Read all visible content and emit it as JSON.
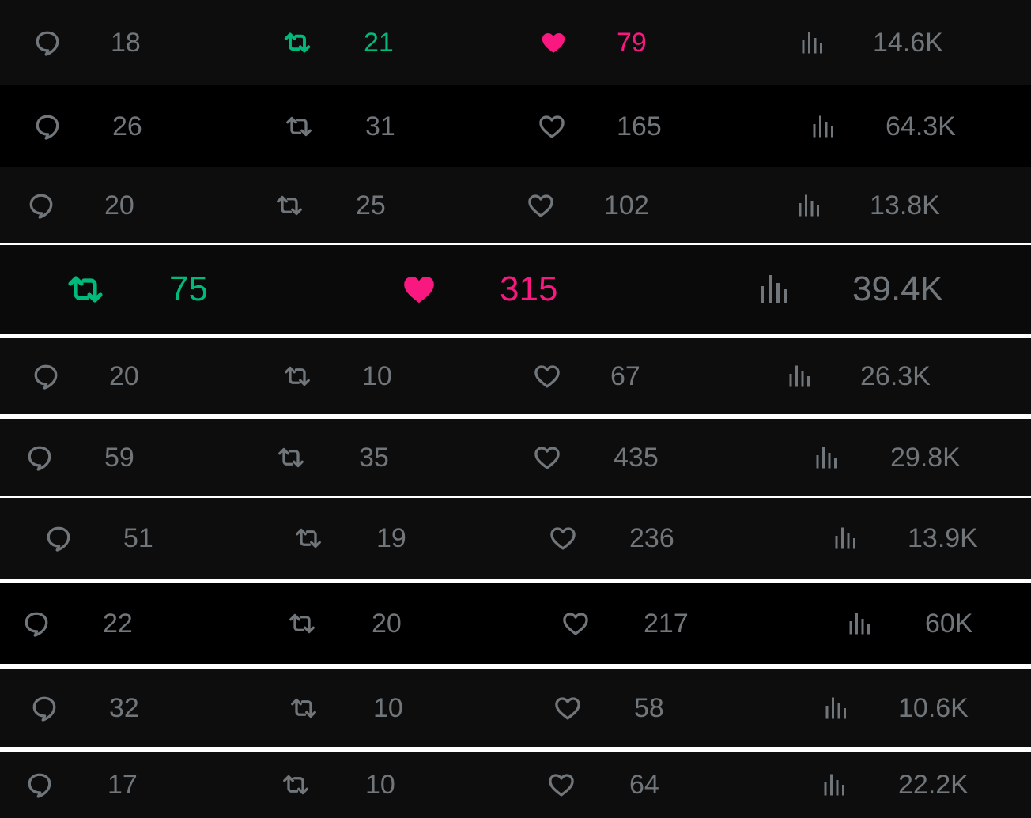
{
  "colors": {
    "muted": "#71767b",
    "retweet_active": "#00ba7c",
    "like_active": "#f91880"
  },
  "strips": [
    {
      "background": "#0d0d0d",
      "reply": "18",
      "retweet": "21",
      "like": "79",
      "views": "14.6K",
      "retweet_active": true,
      "like_active": true
    },
    {
      "background": "#000000",
      "reply": "26",
      "retweet": "31",
      "like": "165",
      "views": "64.3K"
    },
    {
      "background": "#0d0d0d",
      "reply": "20",
      "retweet": "25",
      "like": "102",
      "views": "13.8K"
    },
    {
      "background": "#0a0a0a",
      "retweet": "75",
      "like": "315",
      "views": "39.4K",
      "retweet_active": true,
      "like_active": true
    },
    {
      "background": "#0d0d0d",
      "reply": "20",
      "retweet": "10",
      "like": "67",
      "views": "26.3K"
    },
    {
      "background": "#0d0d0d",
      "reply": "59",
      "retweet": "35",
      "like": "435",
      "views": "29.8K"
    },
    {
      "background": "#0d0d0d",
      "reply": "51",
      "retweet": "19",
      "like": "236",
      "views": "13.9K"
    },
    {
      "background": "#000000",
      "reply": "22",
      "retweet": "20",
      "like": "217",
      "views": "60K"
    },
    {
      "background": "#0d0d0d",
      "reply": "32",
      "retweet": "10",
      "like": "58",
      "views": "10.6K"
    },
    {
      "background": "#0d0d0d",
      "reply": "17",
      "retweet": "10",
      "like": "64",
      "views": "22.2K"
    }
  ]
}
